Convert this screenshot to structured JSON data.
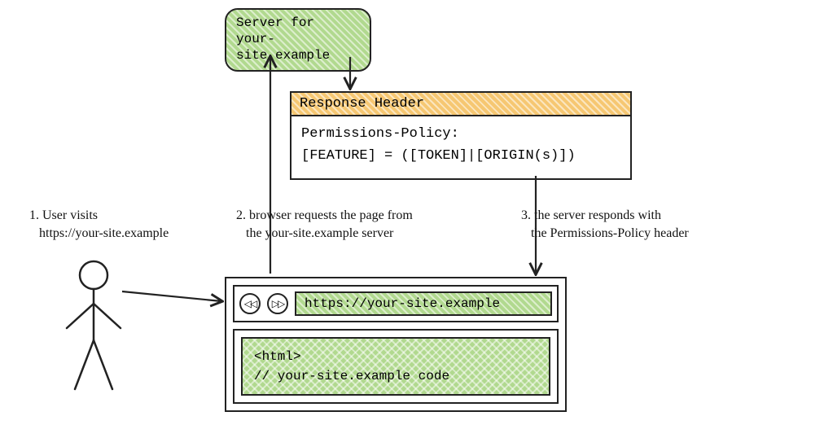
{
  "server": {
    "line1": "Server for",
    "line2": "your-site.example"
  },
  "response": {
    "title": "Response Header",
    "line1": "Permissions-Policy:",
    "line2": "  [FEATURE] = ([TOKEN]|[ORIGIN(s)])"
  },
  "steps": {
    "step1": "1. User visits\n   https://your-site.example",
    "step2": "2. browser requests the page from\n   the your-site.example server",
    "step3": "3. the server responds with\n   the Permissions-Policy header"
  },
  "browser": {
    "back_glyph": "◁◁",
    "fwd_glyph": "▷▷",
    "url": "https://your-site.example",
    "code_line1": "<html>",
    "code_line2": "// your-site.example code"
  }
}
